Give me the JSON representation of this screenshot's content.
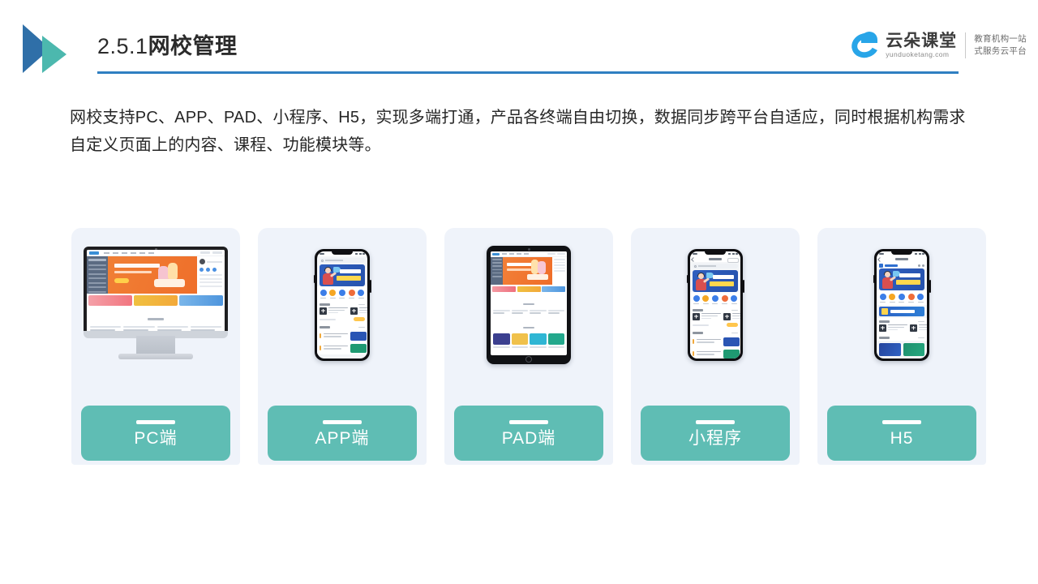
{
  "header": {
    "section_number": "2.5.1",
    "section_title": "网校管理",
    "logo_icon": "double-triangle-play-logo",
    "accent_color": "#2f7fc1"
  },
  "brand": {
    "icon": "cloud-icon",
    "name": "云朵课堂",
    "url": "yunduoketang.com",
    "slogan_line1": "教育机构一站",
    "slogan_line2": "式服务云平台",
    "color": "#28a5e8"
  },
  "body": {
    "paragraph": "网校支持PC、APP、PAD、小程序、H5，实现多端打通，产品各终端自由切换，数据同步跨平台自适应，同时根据机构需求自定义页面上的内容、课程、功能模块等。"
  },
  "cards": [
    {
      "label": "PC端",
      "device": "desktop-monitor-mockup"
    },
    {
      "label": "APP端",
      "device": "smartphone-app-mockup"
    },
    {
      "label": "PAD端",
      "device": "tablet-mockup"
    },
    {
      "label": "小程序",
      "device": "smartphone-miniprogram-mockup"
    },
    {
      "label": "H5",
      "device": "smartphone-h5-mockup"
    }
  ],
  "style": {
    "card_background": "#eff3fa",
    "label_background": "#5fbdb4",
    "label_text_color": "#ffffff"
  }
}
